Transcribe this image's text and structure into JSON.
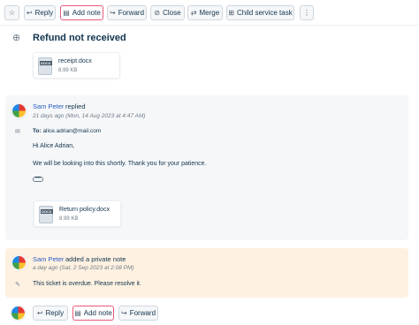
{
  "toolbar": {
    "star_icon": "star-icon",
    "reply": "Reply",
    "add_note": "Add note",
    "forward": "Forward",
    "close": "Close",
    "merge": "Merge",
    "child_task": "Child service task",
    "more": "⋮"
  },
  "ticket": {
    "subject": "Refund not received",
    "attachment": {
      "name": "receipt.docx",
      "size": "8.99 KB",
      "type": "DOCX"
    }
  },
  "reply_message": {
    "author": "Sam Peter",
    "action": "replied",
    "timestamp": "21 days ago (Mon, 14 Aug 2023 at 4:47 AM)",
    "to_label": "To:",
    "to_value": "alice.adrian@mail.com",
    "greeting": "Hi Alice Adrian,",
    "body": "We will be looking into this shortly. Thank you for your patience.",
    "more": "•••",
    "attachment": {
      "name": "Return policy.docx",
      "size": "8.99 KB",
      "type": "DOCX"
    }
  },
  "private_note": {
    "author": "Sam Peter",
    "action": "added a private note",
    "timestamp": "a day ago (Sat, 2 Sep 2023 at 2:08 PM)",
    "body": "This ticket is overdue. Please resolve it."
  },
  "reply_bar": {
    "reply": "Reply",
    "add_note": "Add note",
    "forward": "Forward"
  },
  "colors": {
    "link": "#2c5cc5",
    "highlight_border": "#e75a7c",
    "note_bg": "#fef1e1",
    "message_bg": "#f5f7f9"
  }
}
